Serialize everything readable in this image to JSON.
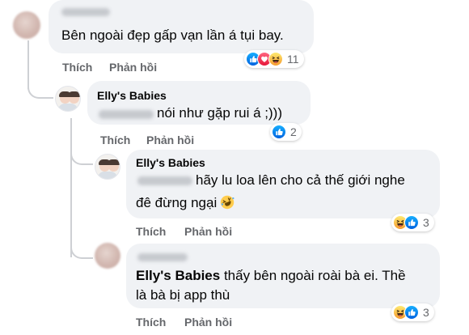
{
  "comments": [
    {
      "author": "",
      "text": "Bên ngoài đẹp gấp vạn lần á tụi bay.",
      "actions": {
        "like": "Thích",
        "reply": "Phản hồi"
      },
      "reactions": {
        "icons": [
          "like-icon",
          "love-icon",
          "haha-icon"
        ],
        "count": "11"
      }
    },
    {
      "author": "Elly's Babies",
      "text": "nói như gặp rui á ;)))",
      "actions": {
        "like": "Thích",
        "reply": "Phản hồi"
      },
      "reactions": {
        "icons": [
          "like-icon"
        ],
        "count": "2"
      }
    },
    {
      "author": "Elly's Babies",
      "text_line1": "hãy lu loa lên cho cả thế giới nghe",
      "text_line2": "đê đừng ngại",
      "actions": {
        "like": "Thích",
        "reply": "Phản hồi"
      },
      "reactions": {
        "icons": [
          "haha-icon",
          "like-icon"
        ],
        "count": "3"
      }
    },
    {
      "author": "",
      "mention": "Elly's Babies",
      "text_line1": " thấy bên ngoài roài bà ei. Thề",
      "text_line2": "là bà bị app thù",
      "actions": {
        "like": "Thích",
        "reply": "Phản hồi"
      },
      "reactions": {
        "icons": [
          "haha-icon",
          "like-icon"
        ],
        "count": "3"
      }
    }
  ],
  "colors": {
    "bubble": "#f0f2f5",
    "action_text": "#65676b",
    "like_blue": "#1877f2",
    "love_red": "#f33e58",
    "haha_yellow": "#f7b125"
  }
}
